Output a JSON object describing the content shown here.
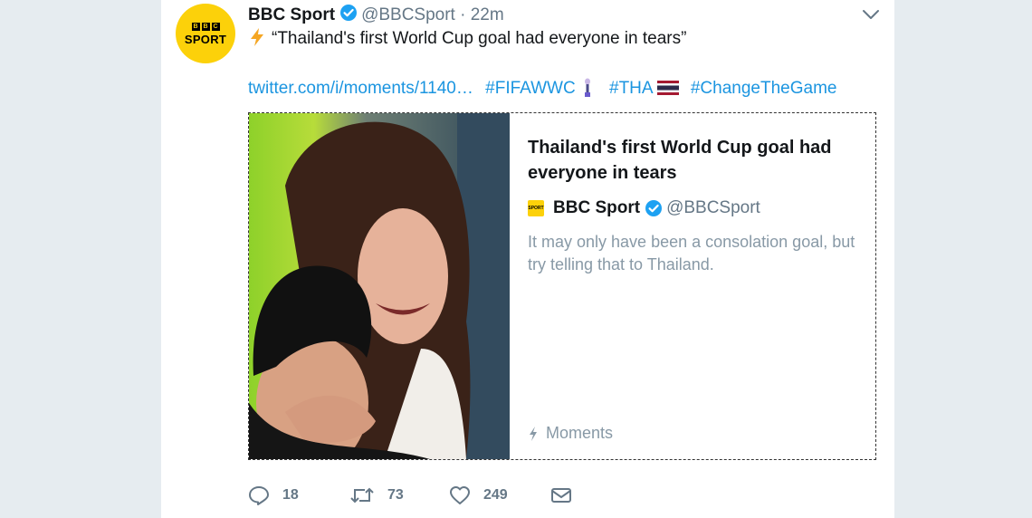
{
  "tweet": {
    "display_name": "BBC Sport",
    "handle": "@BBCSport",
    "separator": "·",
    "time": "22m",
    "avatar": {
      "blocks": [
        "B",
        "B",
        "C"
      ],
      "word": "SPORT"
    },
    "text": "“Thailand's first World Cup goal had everyone in tears”",
    "text_prefix_icon": "lightning-bolt-icon",
    "link": "twitter.com/i/moments/1140…",
    "hashtags": [
      "#FIFAWWC",
      "#THA",
      "#ChangeTheGame"
    ]
  },
  "card": {
    "title": "Thailand's first World Cup goal had everyone in tears",
    "author_name": "BBC Sport",
    "author_handle": "@BBCSport",
    "description": "It may only have been a consolation goal, but try telling that to Thailand.",
    "footer_label": "Moments"
  },
  "actions": {
    "replies": "18",
    "retweets": "73",
    "likes": "249"
  },
  "colors": {
    "link": "#1b95e0",
    "muted": "#657786",
    "brand_yellow": "#fcd10a",
    "verified": "#1da1f2"
  }
}
